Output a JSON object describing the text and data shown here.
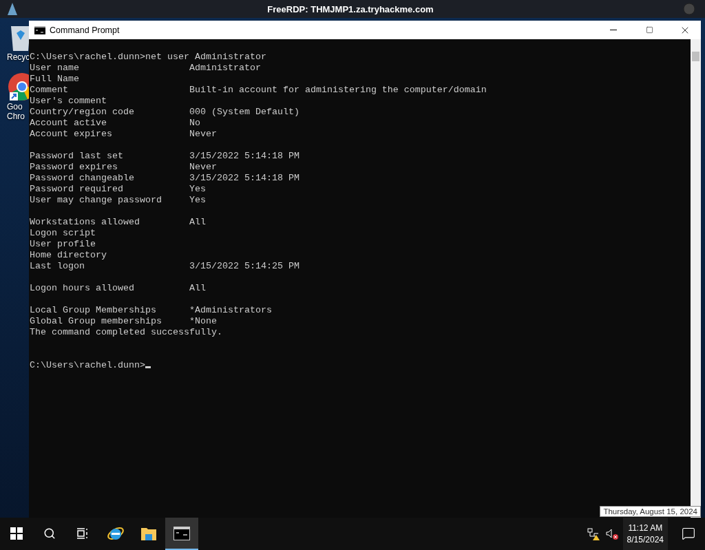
{
  "top_bar": {
    "title": "FreeRDP: THMJMP1.za.tryhackme.com"
  },
  "desktop_icons": [
    {
      "kind": "recycle",
      "lines": [
        "Recyc"
      ]
    },
    {
      "kind": "chrome",
      "lines": [
        "Goo",
        "Chro"
      ]
    }
  ],
  "window": {
    "title": "Command Prompt",
    "command": "C:\\Users\\rachel.dunn>net user Administrator",
    "blocks": [
      [
        {
          "label": "User name",
          "value": "Administrator"
        },
        {
          "label": "Full Name"
        },
        {
          "label": "Comment",
          "value": "Built-in account for administering the computer/domain"
        },
        {
          "label": "User's comment"
        },
        {
          "label": "Country/region code",
          "value": "000 (System Default)"
        },
        {
          "label": "Account active",
          "value": "No"
        },
        {
          "label": "Account expires",
          "value": "Never"
        }
      ],
      [
        {
          "label": "Password last set",
          "value": "3/15/2022 5:14:18 PM"
        },
        {
          "label": "Password expires",
          "value": "Never"
        },
        {
          "label": "Password changeable",
          "value": "3/15/2022 5:14:18 PM"
        },
        {
          "label": "Password required",
          "value": "Yes"
        },
        {
          "label": "User may change password",
          "value": "Yes"
        }
      ],
      [
        {
          "label": "Workstations allowed",
          "value": "All"
        },
        {
          "label": "Logon script"
        },
        {
          "label": "User profile"
        },
        {
          "label": "Home directory"
        },
        {
          "label": "Last logon",
          "value": "3/15/2022 5:14:25 PM"
        }
      ],
      [
        {
          "label": "Logon hours allowed",
          "value": "All"
        }
      ],
      [
        {
          "label": "Local Group Memberships",
          "value": "*Administrators"
        },
        {
          "label": "Global Group memberships",
          "value": "*None"
        },
        {
          "label": "The command completed successfully."
        }
      ]
    ],
    "prompt": "C:\\Users\\rachel.dunn>"
  },
  "taskbar": {
    "items": [
      {
        "kind": "start",
        "selected": false
      },
      {
        "kind": "search",
        "selected": false
      },
      {
        "kind": "taskview",
        "selected": false
      },
      {
        "kind": "ie",
        "selected": false
      },
      {
        "kind": "explorer",
        "selected": false
      },
      {
        "kind": "cmd",
        "selected": true
      }
    ],
    "tooltip": "Thursday, August 15, 2024",
    "time": "11:12 AM",
    "date": "8/15/2024"
  }
}
